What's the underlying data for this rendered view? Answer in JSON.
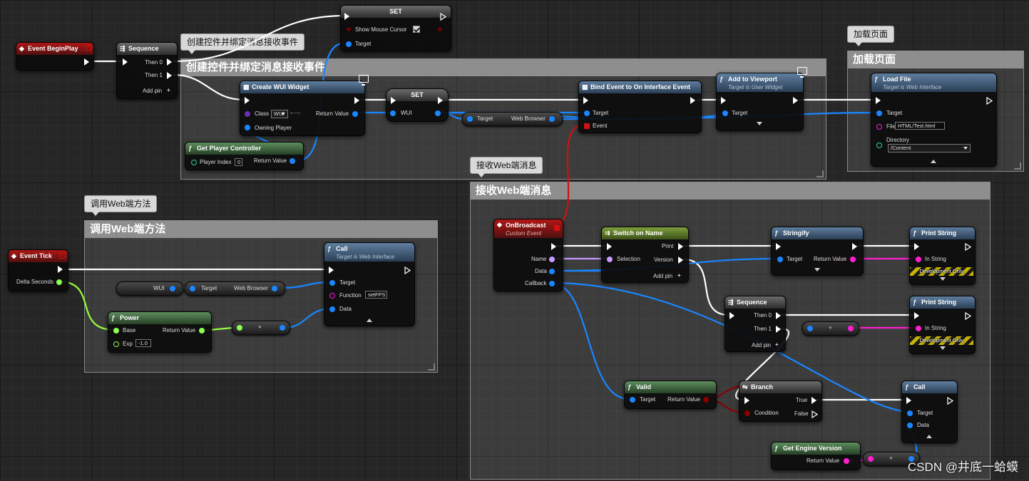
{
  "comments": {
    "create": {
      "bubble": "创建控件并绑定消息接收事件",
      "title": "创建控件并绑定消息接收事件"
    },
    "load": {
      "bubble": "加载页面",
      "title": "加载页面"
    },
    "receive": {
      "bubble": "接收Web端消息",
      "title": "接收Web端消息"
    },
    "call": {
      "bubble": "调用Web端方法",
      "title": "调用Web端方法"
    }
  },
  "nodes": {
    "event_begin_play": {
      "title": "Event BeginPlay"
    },
    "sequence1": {
      "title": "Sequence",
      "then0": "Then 0",
      "then1": "Then 1",
      "add_pin": "Add pin"
    },
    "set_mouse": {
      "title": "SET",
      "show_mouse_cursor": "Show Mouse Cursor",
      "target": "Target",
      "checked": true
    },
    "create_wui": {
      "title": "Create WUI Widget",
      "class": "Class",
      "class_value": "WUI",
      "return_value": "Return Value",
      "owning_player": "Owning Player"
    },
    "set_wui": {
      "title": "SET",
      "var": "WUI"
    },
    "get_player_controller": {
      "title": "Get Player Controller",
      "player_index": "Player Index",
      "player_index_value": "0",
      "return_value": "Return Value"
    },
    "wb_get1": {
      "target": "Target",
      "web_browser": "Web Browser"
    },
    "bind_event": {
      "title": "Bind Event to On Interface Event",
      "target": "Target",
      "event": "Event"
    },
    "add_to_viewport": {
      "title": "Add to Viewport",
      "subtitle": "Target is User Widget",
      "target": "Target"
    },
    "load_file": {
      "title": "Load File",
      "subtitle": "Target is Web Interface",
      "target": "Target",
      "file": "File",
      "file_value": "HTML/Test.html",
      "directory": "Directory",
      "directory_value": "/Content"
    },
    "on_broadcast": {
      "title": "OnBroadcast",
      "subtitle": "Custom Event",
      "name": "Name",
      "data": "Data",
      "callback": "Callback"
    },
    "switch_on_name": {
      "title": "Switch on Name",
      "selection": "Selection",
      "print": "Print",
      "version": "Version",
      "add_pin": "Add pin"
    },
    "stringify": {
      "title": "Stringify",
      "target": "Target",
      "return_value": "Return Value"
    },
    "print_string1": {
      "title": "Print String",
      "in_string": "In String",
      "dev_only": "Development Only"
    },
    "sequence2": {
      "title": "Sequence",
      "then0": "Then 0",
      "then1": "Then 1",
      "add_pin": "Add pin"
    },
    "print_string2": {
      "title": "Print String",
      "in_string": "In String",
      "dev_only": "Development Only"
    },
    "valid": {
      "title": "Valid",
      "target": "Target",
      "return_value": "Return Value"
    },
    "branch": {
      "title": "Branch",
      "condition": "Condition",
      "true": "True",
      "false": "False"
    },
    "call2": {
      "title": "Call",
      "target": "Target",
      "data": "Data"
    },
    "get_engine_version": {
      "title": "Get Engine Version",
      "return_value": "Return Value"
    },
    "event_tick": {
      "title": "Event Tick",
      "delta_seconds": "Delta Seconds"
    },
    "wui_get": {
      "label": "WUI"
    },
    "wb_get2": {
      "target": "Target",
      "web_browser": "Web Browser"
    },
    "call1": {
      "title": "Call",
      "subtitle": "Target is Web Interface",
      "target": "Target",
      "function": "Function",
      "function_value": "setFPS",
      "data": "Data"
    },
    "power": {
      "title": "Power",
      "base": "Base",
      "exp": "Exp",
      "exp_value": "-1.0",
      "return_value": "Return Value"
    }
  },
  "watermark": "CSDN @井底一蛤蟆",
  "colors": {
    "exec": "#ffffff",
    "object": "#1a86ff",
    "string": "#ff1fcf",
    "float": "#95ff3c",
    "name": "#c79bff",
    "delegate": "#d01212"
  }
}
